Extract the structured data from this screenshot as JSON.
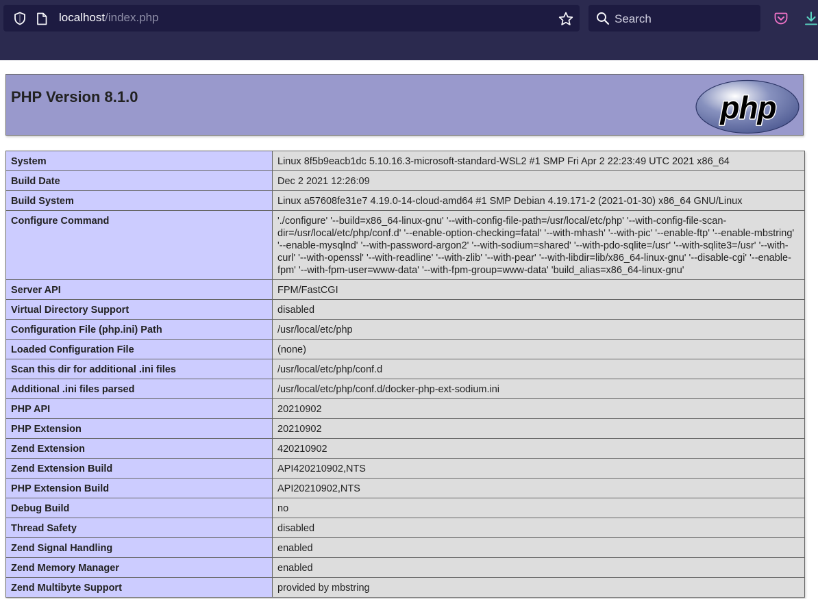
{
  "browser": {
    "url_host": "localhost",
    "url_path": "/index.php",
    "search_placeholder": "Search"
  },
  "page": {
    "title": "PHP Version 8.1.0",
    "logo_text": "php"
  },
  "colors": {
    "chrome_bg": "#2b2a4f",
    "header_bg": "#9999cc",
    "label_cell_bg": "#ccccff",
    "value_cell_bg": "#dddddd"
  },
  "rows": [
    {
      "label": "System",
      "value": "Linux 8f5b9eacb1dc 5.10.16.3-microsoft-standard-WSL2 #1 SMP Fri Apr 2 22:23:49 UTC 2021 x86_64"
    },
    {
      "label": "Build Date",
      "value": "Dec 2 2021 12:26:09"
    },
    {
      "label": "Build System",
      "value": "Linux a57608fe31e7 4.19.0-14-cloud-amd64 #1 SMP Debian 4.19.171-2 (2021-01-30) x86_64 GNU/Linux"
    },
    {
      "label": "Configure Command",
      "value": "'./configure' '--build=x86_64-linux-gnu' '--with-config-file-path=/usr/local/etc/php' '--with-config-file-scan-dir=/usr/local/etc/php/conf.d' '--enable-option-checking=fatal' '--with-mhash' '--with-pic' '--enable-ftp' '--enable-mbstring' '--enable-mysqlnd' '--with-password-argon2' '--with-sodium=shared' '--with-pdo-sqlite=/usr' '--with-sqlite3=/usr' '--with-curl' '--with-openssl' '--with-readline' '--with-zlib' '--with-pear' '--with-libdir=lib/x86_64-linux-gnu' '--disable-cgi' '--enable-fpm' '--with-fpm-user=www-data' '--with-fpm-group=www-data' 'build_alias=x86_64-linux-gnu'"
    },
    {
      "label": "Server API",
      "value": "FPM/FastCGI"
    },
    {
      "label": "Virtual Directory Support",
      "value": "disabled"
    },
    {
      "label": "Configuration File (php.ini) Path",
      "value": "/usr/local/etc/php"
    },
    {
      "label": "Loaded Configuration File",
      "value": "(none)"
    },
    {
      "label": "Scan this dir for additional .ini files",
      "value": "/usr/local/etc/php/conf.d"
    },
    {
      "label": "Additional .ini files parsed",
      "value": "/usr/local/etc/php/conf.d/docker-php-ext-sodium.ini"
    },
    {
      "label": "PHP API",
      "value": "20210902"
    },
    {
      "label": "PHP Extension",
      "value": "20210902"
    },
    {
      "label": "Zend Extension",
      "value": "420210902"
    },
    {
      "label": "Zend Extension Build",
      "value": "API420210902,NTS"
    },
    {
      "label": "PHP Extension Build",
      "value": "API20210902,NTS"
    },
    {
      "label": "Debug Build",
      "value": "no"
    },
    {
      "label": "Thread Safety",
      "value": "disabled"
    },
    {
      "label": "Zend Signal Handling",
      "value": "enabled"
    },
    {
      "label": "Zend Memory Manager",
      "value": "enabled"
    },
    {
      "label": "Zend Multibyte Support",
      "value": "provided by mbstring"
    }
  ]
}
